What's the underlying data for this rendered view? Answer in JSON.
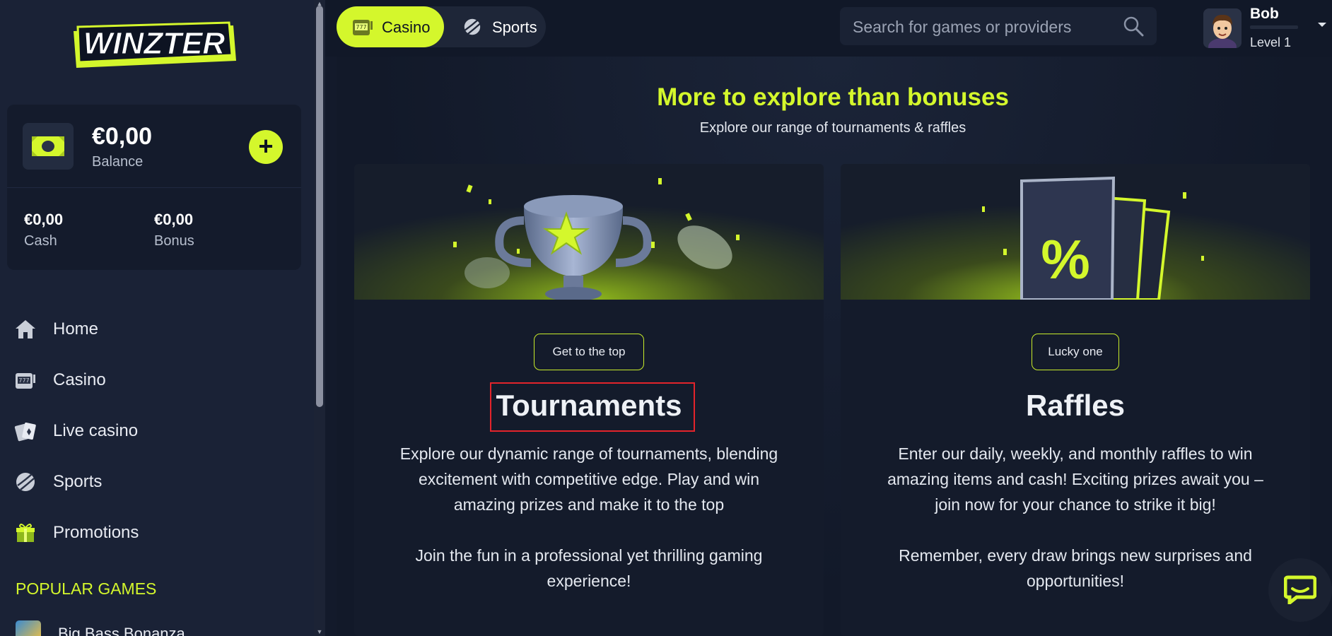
{
  "brand": {
    "name": "WINZTER",
    "accent": "#d4f72c"
  },
  "wallet": {
    "balance": "€0,00",
    "balance_label": "Balance",
    "cash_value": "€0,00",
    "cash_label": "Cash",
    "bonus_value": "€0,00",
    "bonus_label": "Bonus",
    "add_symbol": "+"
  },
  "nav": {
    "items": [
      {
        "label": "Home",
        "icon": "home-icon"
      },
      {
        "label": "Casino",
        "icon": "slot-machine-icon"
      },
      {
        "label": "Live casino",
        "icon": "cards-icon"
      },
      {
        "label": "Sports",
        "icon": "ball-icon"
      },
      {
        "label": "Promotions",
        "icon": "gift-icon"
      }
    ],
    "popular_title": "POPULAR GAMES",
    "popular_games": [
      "Big Bass Bonanza"
    ]
  },
  "header": {
    "tabs": [
      {
        "label": "Casino",
        "active": true
      },
      {
        "label": "Sports",
        "active": false
      }
    ],
    "search_placeholder": "Search for games or providers",
    "user": {
      "name": "Bob",
      "level": "Level 1"
    }
  },
  "main": {
    "title": "More to explore than bonuses",
    "subtitle": "Explore our range of tournaments & raffles",
    "cards": [
      {
        "tag": "Get to the top",
        "title": "Tournaments",
        "body": [
          "Explore our dynamic range of tournaments, blending excitement with competitive edge. Play and win amazing prizes and make it to the top",
          "Join the fun in a professional yet thrilling gaming experience!"
        ]
      },
      {
        "tag": "Lucky one",
        "title": "Raffles",
        "body": [
          "Enter our daily, weekly, and monthly raffles to win amazing items and cash! Exciting prizes await you – join now for your chance to strike it big!",
          "Remember, every draw brings new surprises and opportunities!"
        ]
      }
    ]
  }
}
